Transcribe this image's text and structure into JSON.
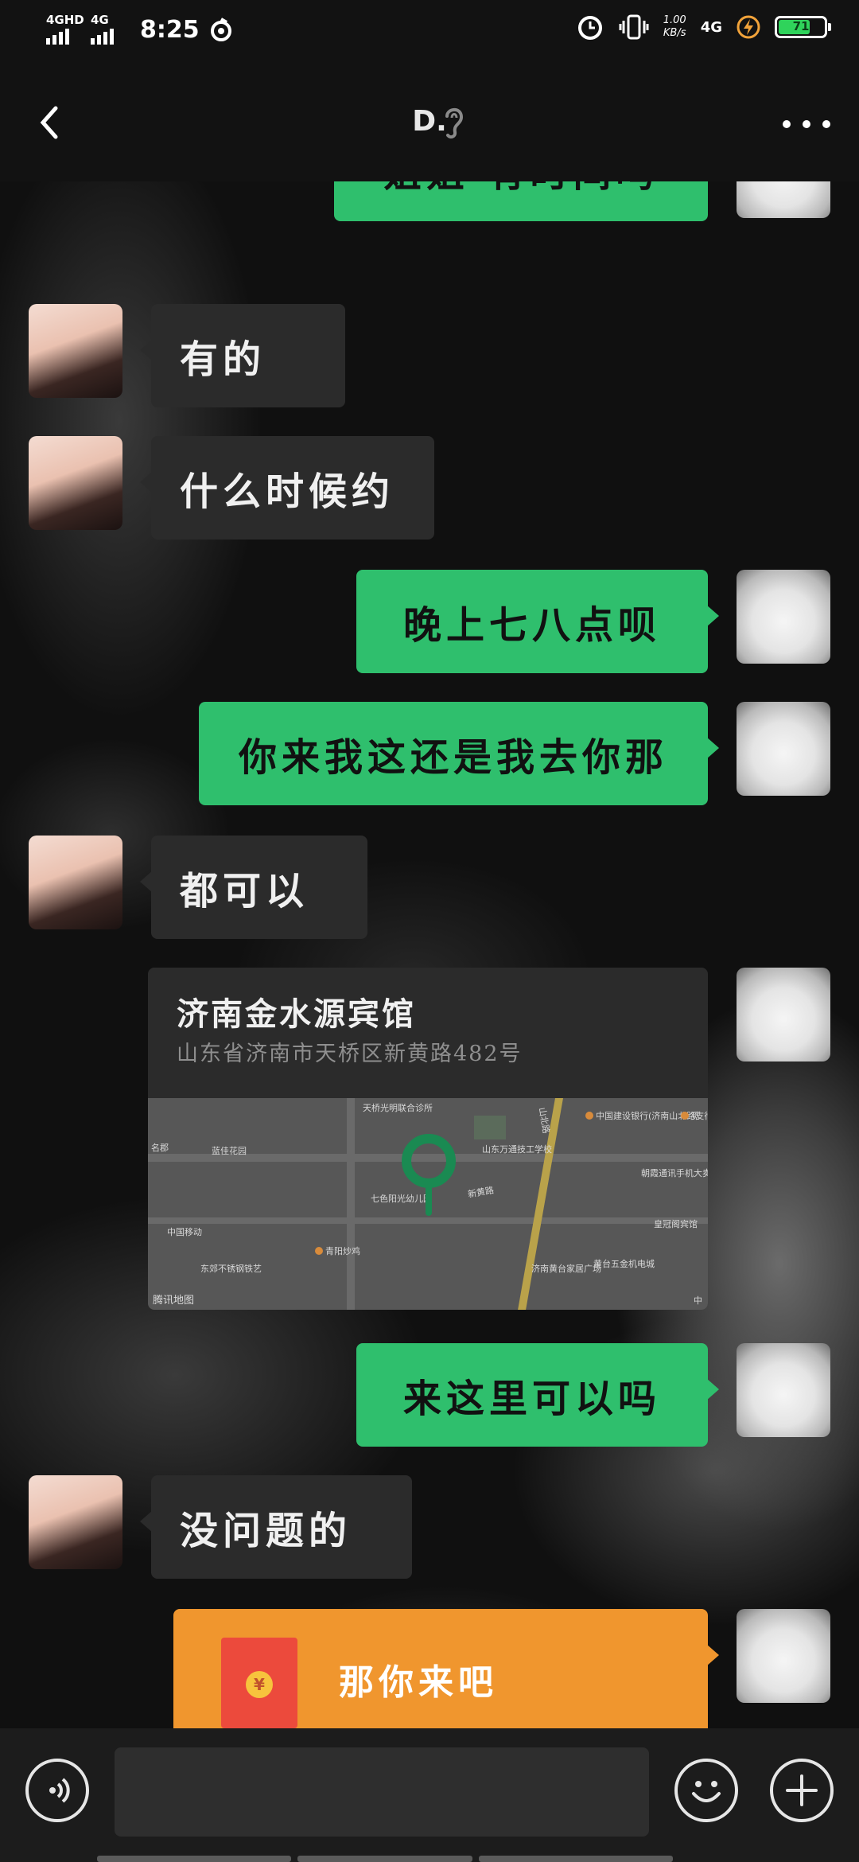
{
  "status_bar": {
    "signal1_label": "4GHD",
    "signal2_label": "4G",
    "time": "8:25",
    "net_speed_value": "1.00",
    "net_speed_unit": "KB/s",
    "network": "4G",
    "battery_level": 71,
    "battery_label": "71",
    "battery_color": "#2fd35b"
  },
  "nav": {
    "title": "D.",
    "back_icon": "chevron-left-icon",
    "more_icon": "more-dots-icon"
  },
  "colors": {
    "outgoing_bubble": "#2fbf6d",
    "incoming_bubble": "#2b2b2b",
    "red_packet": "#f0962e"
  },
  "messages": [
    {
      "from": "me",
      "type": "text",
      "text": "姐姐 有时间吗"
    },
    {
      "from": "other",
      "type": "text",
      "text": "有的"
    },
    {
      "from": "other",
      "type": "text",
      "text": "什么时候约"
    },
    {
      "from": "me",
      "type": "text",
      "text": "晚上七八点呗"
    },
    {
      "from": "me",
      "type": "text",
      "text": "你来我这还是我去你那"
    },
    {
      "from": "other",
      "type": "text",
      "text": "都可以"
    },
    {
      "from": "me",
      "type": "location",
      "name": "济南金水源宾馆",
      "address": "山东省济南市天桥区新黄路482号",
      "map_brand": "腾讯地图",
      "map_labels": [
        "天桥光明联合诊所",
        "山北路",
        "中国建设银行(济南山北路支行)",
        "觅",
        "名郡",
        "蓝佳花园",
        "山东万通技工学校",
        "新黄路",
        "七色阳光幼儿园",
        "朝霞通讯手机大卖场",
        "中国移动",
        "皇冠阁宾馆",
        "东郊不锈钢铁艺",
        "青阳炒鸡",
        "济南黄台家居广场",
        "黄台五金机电城",
        "中"
      ]
    },
    {
      "from": "me",
      "type": "text",
      "text": "来这里可以吗"
    },
    {
      "from": "other",
      "type": "text",
      "text": "没问题的"
    },
    {
      "from": "me",
      "type": "red_packet",
      "text": "那你来吧",
      "icon": "red-packet-icon",
      "coin": "¥"
    }
  ],
  "input_bar": {
    "voice_icon": "voice-icon",
    "emoji_icon": "emoji-icon",
    "plus_icon": "plus-icon",
    "placeholder": ""
  }
}
